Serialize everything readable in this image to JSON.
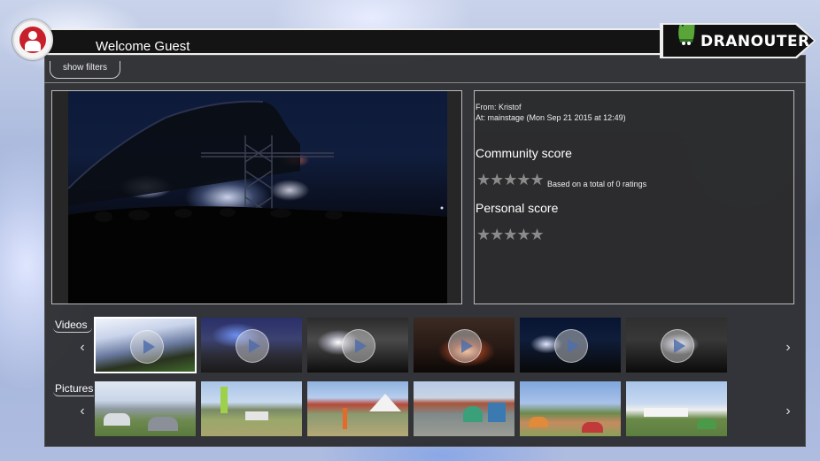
{
  "header": {
    "welcome": "Welcome Guest",
    "brand": "DRANOUTER"
  },
  "filters": {
    "label": "show filters"
  },
  "info": {
    "from": "From: Kristof",
    "at": "At: mainstage (Mon Sep 21 2015 at 12:49)",
    "community_title": "Community score",
    "community_stars": "★★★★★",
    "ratings_text": "Based on a total of 0 ratings",
    "personal_title": "Personal score",
    "personal_stars": "★★★★★"
  },
  "strips": {
    "videos_label": "Videos",
    "pictures_label": "Pictures",
    "prev": "‹",
    "next": "›"
  },
  "colors": {
    "accent": "#c8202a",
    "panel": "#2a2a2c",
    "star": "#8a8a8a"
  }
}
